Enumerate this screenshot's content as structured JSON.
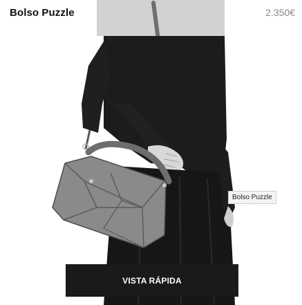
{
  "product": {
    "name": "Bolso Puzzle",
    "price": "2.350€",
    "image_tooltip": "Bolso Puzzle",
    "quick_view_label": "VISTA RÁPIDA"
  },
  "colors": {
    "photo_bg": "#ffffff",
    "clothing": "#1b1b1b",
    "bag": "#8a8a8a",
    "button_bg": "#1a1a1a"
  }
}
